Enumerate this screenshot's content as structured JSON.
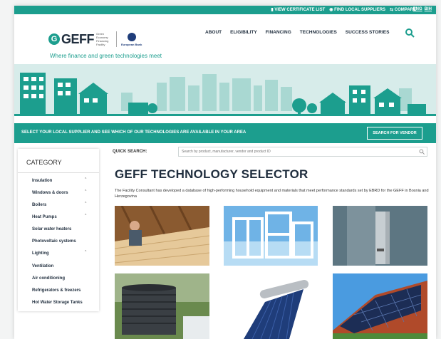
{
  "topbar": {
    "certificate_label": "VIEW CERTIFICATE LIST",
    "suppliers_label": "FIND LOCAL SUPPLIERS",
    "compare_label": "COMPARE",
    "lang_en": "ENG",
    "lang_bih": "BIH"
  },
  "header": {
    "logo_name": "GEFF",
    "logo_sub": "Green Economy Financing Facility",
    "ebrd_name": "European Bank",
    "tagline": "Where finance and green technologies meet",
    "nav": [
      "ABOUT",
      "ELIGIBILITY",
      "FINANCING",
      "TECHNOLOGIES",
      "SUCCESS STORIES"
    ]
  },
  "strip": {
    "text": "SELECT YOUR LOCAL SUPPLIER AND SEE WHICH OF OUR TECHNOLOGIES ARE AVAILABLE IN YOUR AREA",
    "button": "SEARCH FOR VENDOR"
  },
  "sidebar": {
    "heading": "CATEGORY",
    "items": [
      {
        "label": "Insulation",
        "expandable": true
      },
      {
        "label": "Windows & doors",
        "expandable": true
      },
      {
        "label": "Boilers",
        "expandable": true
      },
      {
        "label": "Heat Pumps",
        "expandable": true
      },
      {
        "label": "Solar water heaters",
        "expandable": false
      },
      {
        "label": "Photovoltaic systems",
        "expandable": false
      },
      {
        "label": "Lighting",
        "expandable": true
      },
      {
        "label": "Ventilation",
        "expandable": false
      },
      {
        "label": "Air conditioning",
        "expandable": false
      },
      {
        "label": "Refrigerators & freezers",
        "expandable": false
      },
      {
        "label": "Hot Water Storage Tanks",
        "expandable": false
      }
    ]
  },
  "search": {
    "label": "QUICK SEARCH:",
    "placeholder": "Search by product, manufacturer, vendor and product ID"
  },
  "main": {
    "title": "GEFF TECHNOLOGY SELECTOR",
    "description": "The Facility Consultant has developed a database of high-performing household equipment and materials that meet performance standards set by EBRD for the GEFF in Bosnia and Herzegovina"
  },
  "colors": {
    "brand_teal": "#1c9e8e",
    "dark_text": "#1f2d3d"
  },
  "icons": {
    "search": "search-icon",
    "chevron": "chevron-up-icon",
    "certificate": "document-icon",
    "suppliers": "pin-icon",
    "compare": "compare-icon"
  }
}
